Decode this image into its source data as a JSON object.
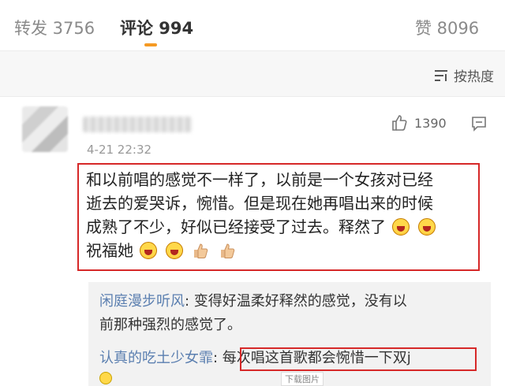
{
  "tabs": {
    "repost": "转发 3756",
    "comment": "评论 994",
    "like": "赞 8096"
  },
  "sort": {
    "label": "按热度"
  },
  "comment": {
    "time": "4-21 22:32",
    "likes": "1390",
    "lines": [
      "和以前唱的感觉不一样了，以前是一个女孩对已经",
      "逝去的爱哭诉，惋惜。但是现在她再唱出来的时候",
      "成熟了不少，好似已经接受了过去。释然了",
      "祝福她"
    ]
  },
  "replies": [
    {
      "user": "闲庭漫步听风",
      "text": "变得好温柔好释然的感觉，没有以"
    },
    {
      "text_cont": "前那种强烈的感觉了。"
    },
    {
      "user": "认真的吃土少女霏",
      "text": "每次唱这首歌都会惋惜一下双j"
    }
  ],
  "view_image_label": "下载图片",
  "colors": {
    "accent": "#f59a23",
    "highlight": "#d62828",
    "link": "#5b7fb0"
  }
}
